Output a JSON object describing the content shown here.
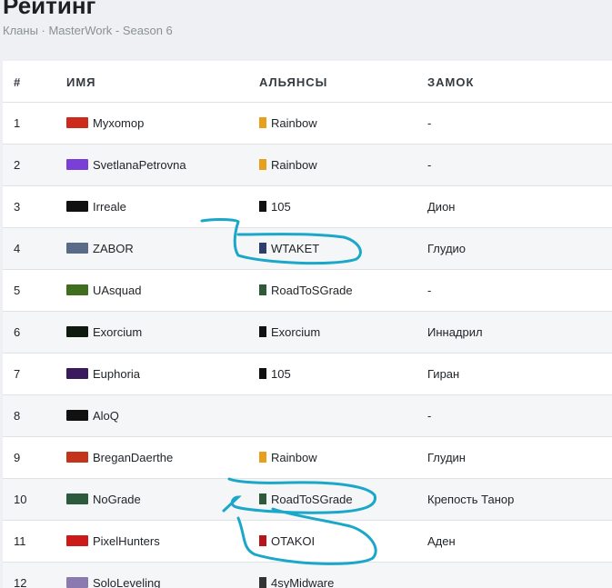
{
  "header": {
    "title": "Рейтинг",
    "breadcrumb": "Кланы · MasterWork - Season 6"
  },
  "table": {
    "columns": [
      "#",
      "ИМЯ",
      "АЛЬЯНСЫ",
      "ЗАМОК"
    ],
    "rows": [
      {
        "num": "1",
        "name": "Myxomop",
        "crest_color": "#cc2a1a",
        "alliance": "Rainbow",
        "ally_color": "#e8a01c",
        "castle": "-"
      },
      {
        "num": "2",
        "name": "SvetlanaPetrovna",
        "crest_color": "#7a3fd6",
        "alliance": "Rainbow",
        "ally_color": "#e8a01c",
        "castle": "-"
      },
      {
        "num": "3",
        "name": "Irreale",
        "crest_color": "#111111",
        "alliance": "105",
        "ally_color": "#111111",
        "castle": "Дион"
      },
      {
        "num": "4",
        "name": "ZABOR",
        "crest_color": "#5a6b8a",
        "alliance": "WTAKET",
        "ally_color": "#2c3e6b",
        "castle": "Глудио"
      },
      {
        "num": "5",
        "name": "UAsquad",
        "crest_color": "#3f6e1f",
        "alliance": "RoadToSGrade",
        "ally_color": "#2e5a3a",
        "castle": "-"
      },
      {
        "num": "6",
        "name": "Exorcium",
        "crest_color": "#0d1a0d",
        "alliance": "Exorcium",
        "ally_color": "#111111",
        "castle": "Иннадрил"
      },
      {
        "num": "7",
        "name": "Euphoria",
        "crest_color": "#3a1a5c",
        "alliance": "105",
        "ally_color": "#111111",
        "castle": "Гиран"
      },
      {
        "num": "8",
        "name": "AloQ",
        "crest_color": "#111111",
        "alliance": "",
        "ally_color": "",
        "castle": "-"
      },
      {
        "num": "9",
        "name": "BreganDaerthe",
        "crest_color": "#c4341a",
        "alliance": "Rainbow",
        "ally_color": "#e8a01c",
        "castle": "Глудин"
      },
      {
        "num": "10",
        "name": "NoGrade",
        "crest_color": "#2d5a3d",
        "alliance": "RoadToSGrade",
        "ally_color": "#2e5a3a",
        "castle": "Крепость Танор"
      },
      {
        "num": "11",
        "name": "PixelHunters",
        "crest_color": "#cc1a1a",
        "alliance": "OTAKOI",
        "ally_color": "#b8141a",
        "castle": "Аден"
      },
      {
        "num": "12",
        "name": "SoloLeveling",
        "crest_color": "#8a7ab0",
        "alliance": "4syMidware",
        "ally_color": "#333333",
        "castle": ""
      }
    ]
  },
  "annotation_color": "#1aa7c9"
}
